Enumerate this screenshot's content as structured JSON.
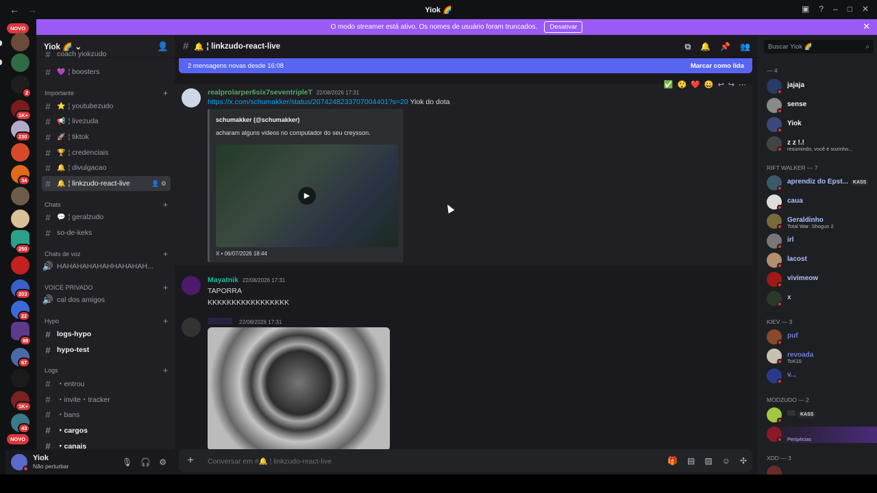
{
  "titlebar": {
    "title": "Yiok 🌈",
    "back": "←",
    "forward": "→",
    "inbox": "▣",
    "help": "?",
    "minimize": "–",
    "maximize": "□",
    "close": "✕"
  },
  "banner": {
    "text": "O modo streamer está ativo. Os nomes de usuário foram truncados.",
    "button": "Desativar",
    "close": "✕"
  },
  "guilds": {
    "badges": [
      "NOVO",
      "2",
      "1K+",
      "230",
      "34",
      "250",
      "203",
      "22",
      "88",
      "67",
      "1K+",
      "43",
      "NOVO"
    ]
  },
  "server": {
    "name": "Yiok 🌈",
    "chevron": "⌄",
    "add_user_icon": "👤"
  },
  "sidebar": {
    "top_partial": "coach yiokzudo",
    "boosters": "¦ boosters",
    "cat_importante": "Importante",
    "youtubezudo": "¦ youtubezudo",
    "livezuda": "¦ livezuda",
    "tiktok": "¦ tiktok",
    "credenciais": "¦ credenciais",
    "divulgacao": "¦ divulgacao",
    "linkzudo": "¦ linkzudo-react-live",
    "cat_chats": "Chats",
    "geralzudo": "¦ geralzudo",
    "sodekeks": "so-de-keks",
    "cat_voz": "Chats de voz",
    "voz1": "HAHAHAHAHAHHAHAHAH...",
    "cat_voice": "VOICE PRIVADO",
    "amigos": "cal dos amigos",
    "cat_hypo": "Hypo",
    "logshypo": "logs-hypo",
    "hypotest": "hypo-test",
    "cat_logs": "Logs",
    "entrou": "・entrou",
    "invite": "・invite・tracker",
    "bans": "・bans",
    "cargos": "・cargos",
    "canais": "・canais"
  },
  "user": {
    "name": "Yiok",
    "status": "Não perturbar"
  },
  "channel": {
    "name": "¦ linkzudo-react-live",
    "emoji": "🔔"
  },
  "newmsg": {
    "text": "2 mensagens novas desde 16:08",
    "mark": "Marcar como lida"
  },
  "msg1": {
    "author": "realprolarper6six7seventripleT",
    "time": "22/08/2026 17:31",
    "link": "https://x.com/schumakker/status/2074248233707004401?s=20",
    "text": " Yiok do dota",
    "embed_author": "schumakker (@schumakker)",
    "embed_desc": "acharam alguns videos no computador do seu creysson.",
    "embed_footer": "X • 06/07/2026 18:44",
    "play": "▶"
  },
  "msg2": {
    "author": "Mayatnik",
    "time": "22/08/2026 17:31",
    "line1": "TAPORRA",
    "line2": "KKKKKKKKKKKKKKKKK"
  },
  "msg3": {
    "time": "22/08/2026 17:31"
  },
  "reactions": [
    "✅",
    "😲",
    "❤️",
    "😀",
    "↩",
    "↪",
    "⋯"
  ],
  "composer": {
    "placeholder": "Conversar em #🔔 ¦ linkzudo-react-live",
    "plus": "+"
  },
  "members": {
    "search": "Buscar Yiok 🌈",
    "g1": "— 4",
    "m1": "jajaja",
    "m2": "sense",
    "m3": "Yiok",
    "m4": "z z !.!",
    "m4s": "resumindo, você é sozinho...",
    "g2": "RIFT WALKER — 7",
    "m5": "aprendiz do Epst...",
    "m5t": "KASS",
    "m6": "caua",
    "m7": "Geraldinho",
    "m7s": "Total War: Shogun 2",
    "m8": "irl",
    "m9": "lacost",
    "m10": "vivimeow",
    "m11": "x",
    "g3": "kiev — 3",
    "m12": "puf",
    "m13": "revoada",
    "m13s": "TcK10",
    "m14": "v...",
    "g4": "MODZUDO — 2",
    "m15t": "KASS",
    "m16s": "Peripécias",
    "g5": "xDD — 3"
  }
}
